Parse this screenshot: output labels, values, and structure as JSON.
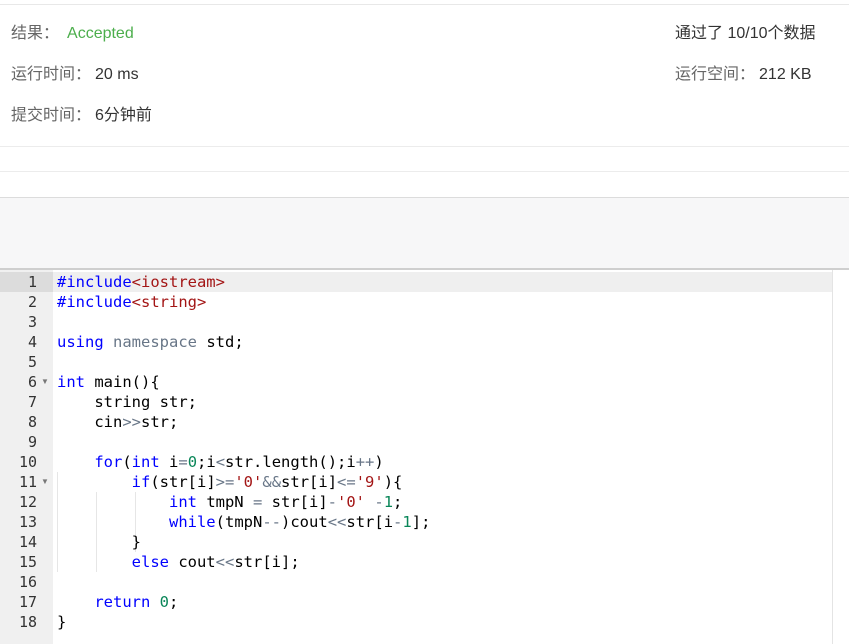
{
  "result": {
    "result_label": "结果：",
    "result_value": "Accepted",
    "passed_text": "通过了 10/10个数据",
    "runtime_label": "运行时间：",
    "runtime_value": "20 ms",
    "memory_label": "运行空间：",
    "memory_value": "212 KB",
    "submit_label": "提交时间：",
    "submit_value": "6分钟前"
  },
  "colors": {
    "accepted": "#4cae4c",
    "keyword": "#0000ff",
    "string": "#a31515",
    "number": "#098658"
  },
  "editor": {
    "line_numbers": [
      "1",
      "2",
      "3",
      "4",
      "5",
      "6",
      "7",
      "8",
      "9",
      "10",
      "11",
      "12",
      "13",
      "14",
      "15",
      "16",
      "17",
      "18"
    ],
    "fold_marker_icon": "fold-arrow-icon",
    "fold_lines": [
      "6",
      "11"
    ],
    "code": [
      "#include<iostream>",
      "#include<string>",
      "",
      "using namespace std;",
      "",
      "int main(){",
      "    string str;",
      "    cin>>str;",
      "",
      "    for(int i=0;i<str.length();i++)",
      "        if(str[i]>='0'&&str[i]<='9'){",
      "            int tmpN = str[i]-'0' -1;",
      "            while(tmpN--)cout<<str[i-1];",
      "        }",
      "        else cout<<str[i];",
      "",
      "    return 0;",
      "}"
    ]
  }
}
